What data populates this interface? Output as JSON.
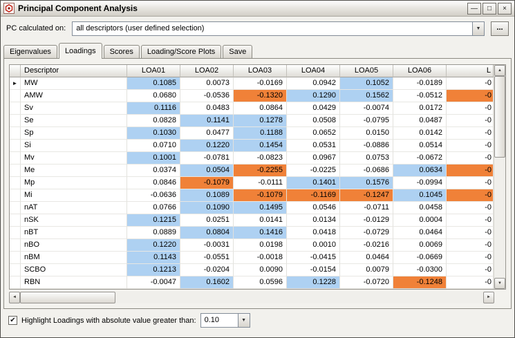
{
  "window": {
    "title": "Principal Component Analysis"
  },
  "icons": {
    "minimize": "—",
    "maximize": "□",
    "close": "×",
    "dropdown": "▼",
    "scroll_up": "▲",
    "scroll_down": "▼",
    "scroll_left": "◄",
    "scroll_right": "►",
    "check": "✔",
    "row_marker": "►"
  },
  "colors": {
    "highlight_positive": "#aed1f2",
    "highlight_negative": "#f08138"
  },
  "toolbar": {
    "pc_label": "PC calculated on:",
    "pc_value": "all descriptors (user defined selection)",
    "browse_label": "..."
  },
  "tabs": [
    {
      "label": "Eigenvalues"
    },
    {
      "label": "Loadings"
    },
    {
      "label": "Scores"
    },
    {
      "label": "Loading/Score Plots"
    },
    {
      "label": "Save"
    }
  ],
  "grid": {
    "label_header": "Descriptor",
    "value_headers": [
      "LOA01",
      "LOA02",
      "LOA03",
      "LOA04",
      "LOA05",
      "LOA06"
    ],
    "partial_header": "L",
    "rows": [
      {
        "label": "MW",
        "current": true,
        "values": [
          "0.1085",
          "0.0073",
          "-0.0169",
          "0.0942",
          "0.1052",
          "-0.0189"
        ],
        "hl": [
          "pos",
          "",
          "",
          "",
          "pos",
          ""
        ],
        "partial": "-0",
        "partial_hl": ""
      },
      {
        "label": "AMW",
        "current": false,
        "values": [
          "0.0680",
          "-0.0536",
          "-0.1320",
          "0.1290",
          "0.1562",
          "-0.0512"
        ],
        "hl": [
          "",
          "",
          "neg",
          "pos",
          "pos",
          ""
        ],
        "partial": "-0",
        "partial_hl": "neg"
      },
      {
        "label": "Sv",
        "current": false,
        "values": [
          "0.1116",
          "0.0483",
          "0.0864",
          "0.0429",
          "-0.0074",
          "0.0172"
        ],
        "hl": [
          "pos",
          "",
          "",
          "",
          "",
          ""
        ],
        "partial": "-0",
        "partial_hl": ""
      },
      {
        "label": "Se",
        "current": false,
        "values": [
          "0.0828",
          "0.1141",
          "0.1278",
          "0.0508",
          "-0.0795",
          "0.0487"
        ],
        "hl": [
          "",
          "pos",
          "pos",
          "",
          "",
          ""
        ],
        "partial": "-0",
        "partial_hl": ""
      },
      {
        "label": "Sp",
        "current": false,
        "values": [
          "0.1030",
          "0.0477",
          "0.1188",
          "0.0652",
          "0.0150",
          "0.0142"
        ],
        "hl": [
          "pos",
          "",
          "pos",
          "",
          "",
          ""
        ],
        "partial": "-0",
        "partial_hl": ""
      },
      {
        "label": "Si",
        "current": false,
        "values": [
          "0.0710",
          "0.1220",
          "0.1454",
          "0.0531",
          "-0.0886",
          "0.0514"
        ],
        "hl": [
          "",
          "pos",
          "pos",
          "",
          "",
          ""
        ],
        "partial": "-0",
        "partial_hl": ""
      },
      {
        "label": "Mv",
        "current": false,
        "values": [
          "0.1001",
          "-0.0781",
          "-0.0823",
          "0.0967",
          "0.0753",
          "-0.0672"
        ],
        "hl": [
          "pos",
          "",
          "",
          "",
          "",
          ""
        ],
        "partial": "-0",
        "partial_hl": ""
      },
      {
        "label": "Me",
        "current": false,
        "values": [
          "0.0374",
          "0.0504",
          "-0.2255",
          "-0.0225",
          "-0.0686",
          "0.0634"
        ],
        "hl": [
          "",
          "pos",
          "neg",
          "",
          "",
          "pos"
        ],
        "partial": "-0",
        "partial_hl": "neg"
      },
      {
        "label": "Mp",
        "current": false,
        "values": [
          "0.0846",
          "-0.1079",
          "-0.0111",
          "0.1401",
          "0.1576",
          "-0.0994"
        ],
        "hl": [
          "",
          "neg",
          "",
          "pos",
          "pos",
          ""
        ],
        "partial": "-0",
        "partial_hl": ""
      },
      {
        "label": "Mi",
        "current": false,
        "values": [
          "-0.0636",
          "0.1089",
          "-0.1079",
          "-0.1169",
          "-0.1247",
          "0.1045"
        ],
        "hl": [
          "",
          "pos",
          "neg",
          "neg",
          "neg",
          "pos"
        ],
        "partial": "-0",
        "partial_hl": "neg"
      },
      {
        "label": "nAT",
        "current": false,
        "values": [
          "0.0766",
          "0.1090",
          "0.1495",
          "0.0546",
          "-0.0711",
          "0.0458"
        ],
        "hl": [
          "",
          "pos",
          "pos",
          "",
          "",
          ""
        ],
        "partial": "-0",
        "partial_hl": ""
      },
      {
        "label": "nSK",
        "current": false,
        "values": [
          "0.1215",
          "0.0251",
          "0.0141",
          "0.0134",
          "-0.0129",
          "0.0004"
        ],
        "hl": [
          "pos",
          "",
          "",
          "",
          "",
          ""
        ],
        "partial": "-0",
        "partial_hl": ""
      },
      {
        "label": "nBT",
        "current": false,
        "values": [
          "0.0889",
          "0.0804",
          "0.1416",
          "0.0418",
          "-0.0729",
          "0.0464"
        ],
        "hl": [
          "",
          "pos",
          "pos",
          "",
          "",
          ""
        ],
        "partial": "-0",
        "partial_hl": ""
      },
      {
        "label": "nBO",
        "current": false,
        "values": [
          "0.1220",
          "-0.0031",
          "0.0198",
          "0.0010",
          "-0.0216",
          "0.0069"
        ],
        "hl": [
          "pos",
          "",
          "",
          "",
          "",
          ""
        ],
        "partial": "-0",
        "partial_hl": ""
      },
      {
        "label": "nBM",
        "current": false,
        "values": [
          "0.1143",
          "-0.0551",
          "-0.0018",
          "-0.0415",
          "0.0464",
          "-0.0669"
        ],
        "hl": [
          "pos",
          "",
          "",
          "",
          "",
          ""
        ],
        "partial": "-0",
        "partial_hl": ""
      },
      {
        "label": "SCBO",
        "current": false,
        "values": [
          "0.1213",
          "-0.0204",
          "0.0090",
          "-0.0154",
          "0.0079",
          "-0.0300"
        ],
        "hl": [
          "pos",
          "",
          "",
          "",
          "",
          ""
        ],
        "partial": "-0",
        "partial_hl": ""
      },
      {
        "label": "RBN",
        "current": false,
        "values": [
          "-0.0047",
          "0.1602",
          "0.0596",
          "0.1228",
          "-0.0720",
          "-0.1248"
        ],
        "hl": [
          "",
          "pos",
          "",
          "pos",
          "",
          "neg"
        ],
        "partial": "-0",
        "partial_hl": ""
      }
    ]
  },
  "footer": {
    "checkbox_label": "Highlight Loadings with absolute value greater than:",
    "checkbox_checked": true,
    "threshold_value": "0.10"
  }
}
